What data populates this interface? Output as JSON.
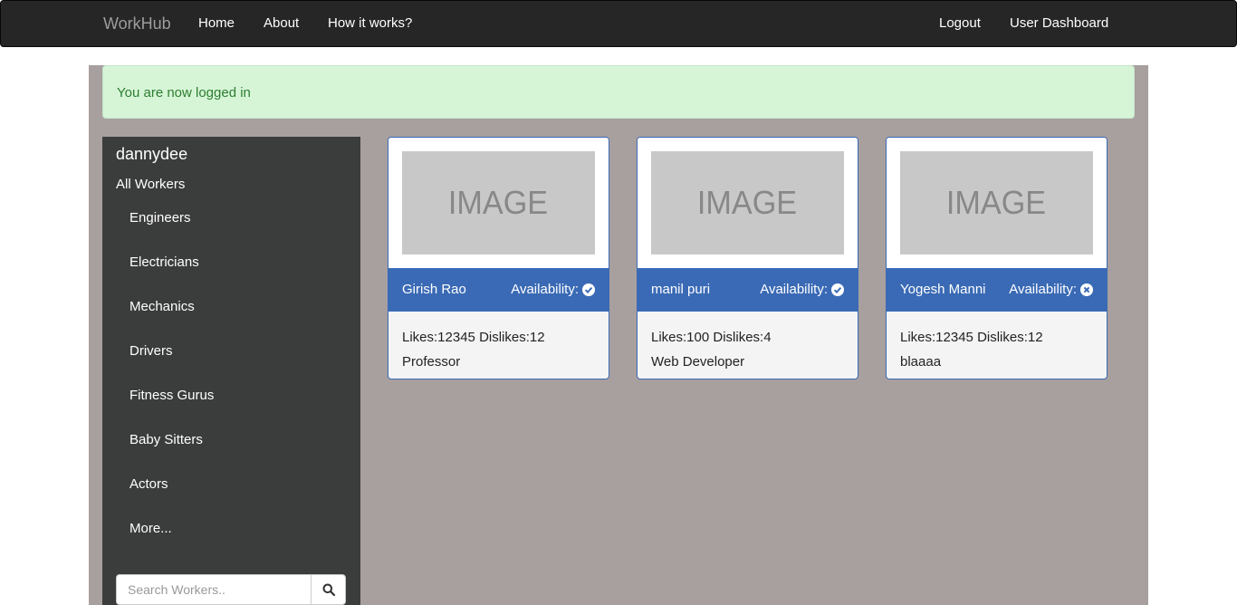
{
  "navbar": {
    "brand": "WorkHub",
    "links": [
      "Home",
      "About",
      "How it works?"
    ],
    "right_links": [
      "Logout",
      "User Dashboard"
    ]
  },
  "alert": {
    "message": "You are now logged in"
  },
  "sidebar": {
    "username": "dannydee",
    "all_workers": "All Workers",
    "categories": [
      "Engineers",
      "Electricians",
      "Mechanics",
      "Drivers",
      "Fitness Gurus",
      "Baby Sitters",
      "Actors",
      "More..."
    ],
    "search_placeholder": "Search Workers.."
  },
  "workers": [
    {
      "image_label": "IMAGE",
      "name": "Girish Rao",
      "availability_label": "Availability:",
      "available": true,
      "availability_icon": "check-circle-icon",
      "stats": "Likes:12345 Dislikes:12",
      "profession": "Professor"
    },
    {
      "image_label": "IMAGE",
      "name": "manil puri",
      "availability_label": "Availability:",
      "available": true,
      "availability_icon": "check-circle-icon",
      "stats": "Likes:100 Dislikes:4",
      "profession": "Web Developer"
    },
    {
      "image_label": "IMAGE",
      "name": "Yogesh Manni",
      "availability_label": "Availability:",
      "available": false,
      "availability_icon": "x-circle-icon",
      "stats": "Likes:12345 Dislikes:12",
      "profession": "blaaaa"
    }
  ],
  "colors": {
    "navbar_bg": "#262626",
    "container_bg": "#a89f9f",
    "sidebar_bg": "#3b3c3c",
    "card_header": "#3a6ab5",
    "alert_bg": "#d6f5d6",
    "alert_text": "#2e7d32"
  }
}
